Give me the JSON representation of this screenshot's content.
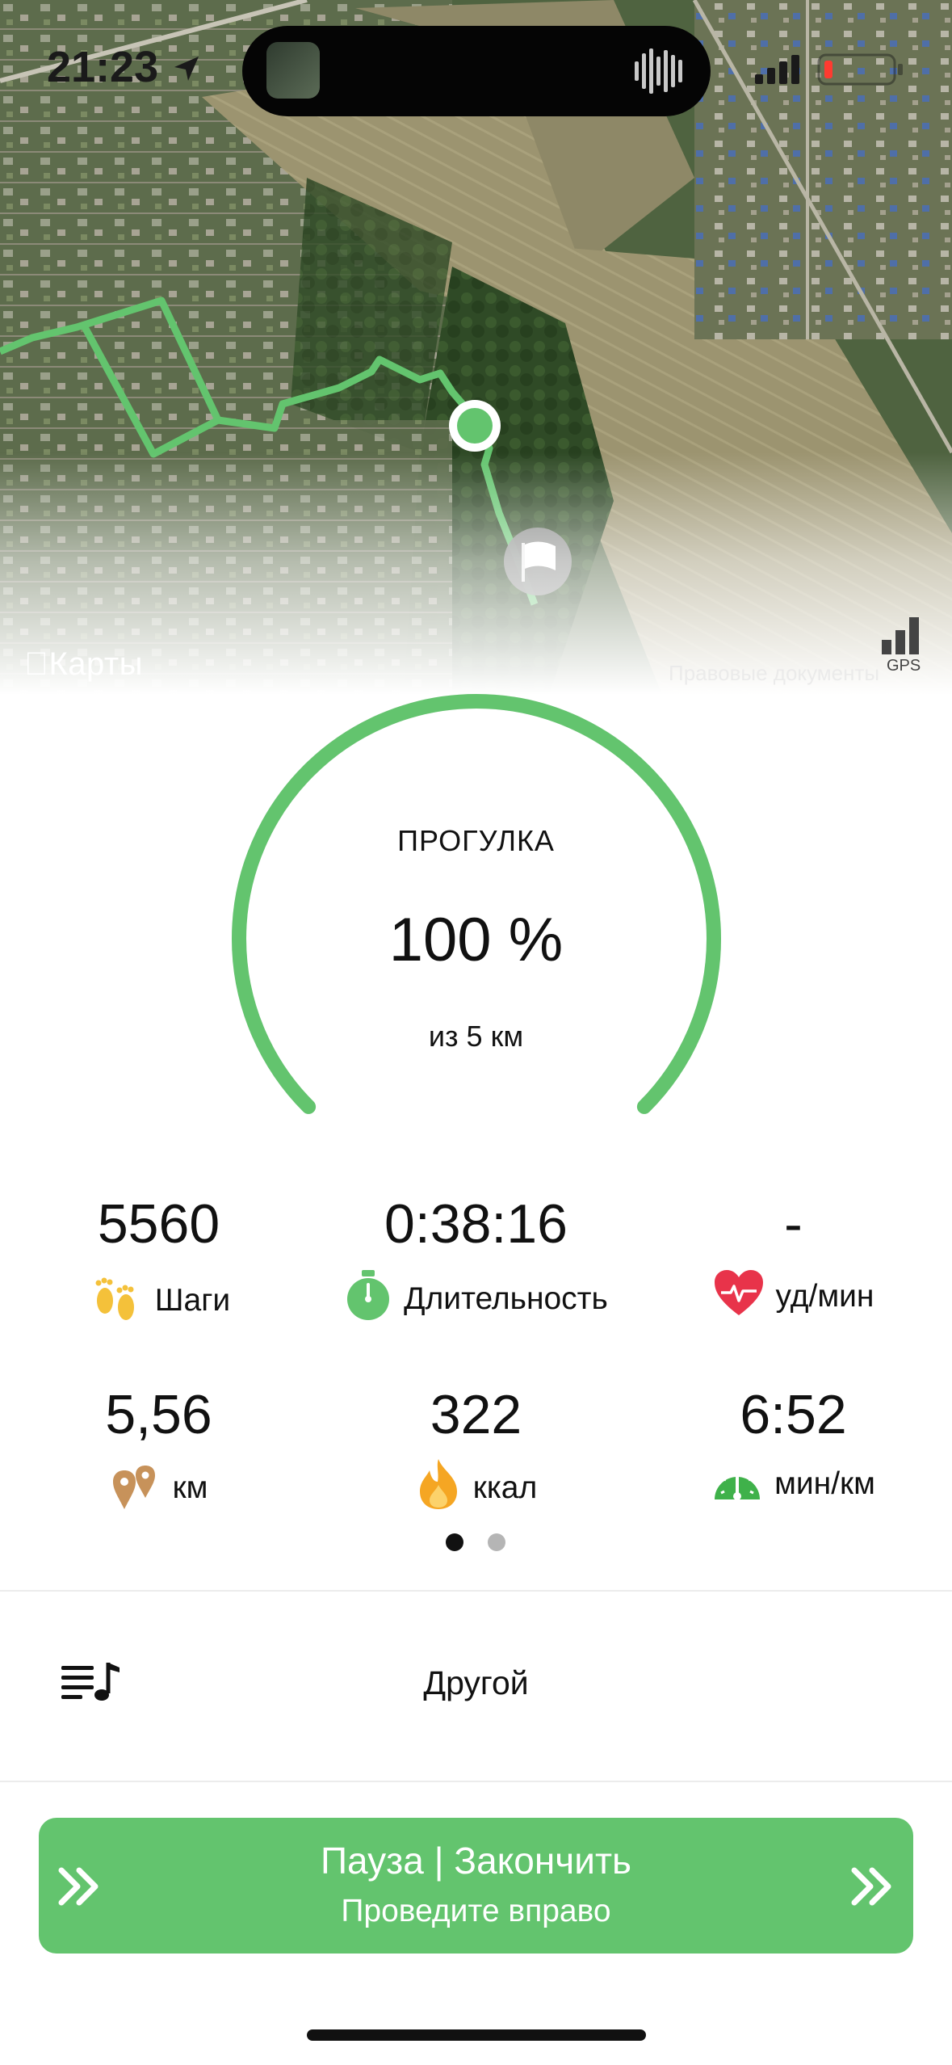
{
  "status_bar": {
    "time": "21:23"
  },
  "map": {
    "provider_label": "Карты",
    "legal_label": "Правовые документы",
    "gps_label": "GPS",
    "route_color": "#63c46e"
  },
  "activity": {
    "type": "ПРОГУЛКА",
    "progress_percent": 100,
    "progress_text": "100 %",
    "goal_text": "из 5 км",
    "accent_color": "#63c46e"
  },
  "stats": {
    "steps": {
      "value": "5560",
      "label": "Шаги",
      "icon": "footprints-icon"
    },
    "duration": {
      "value": "0:38:16",
      "label": "Длительность",
      "icon": "stopwatch-icon"
    },
    "heart_rate": {
      "value": "-",
      "label": "уд/мин",
      "icon": "heart-icon"
    },
    "distance": {
      "value": "5,56",
      "label": "км",
      "icon": "location-pins-icon"
    },
    "calories": {
      "value": "322",
      "label": "ккал",
      "icon": "flame-icon"
    },
    "pace": {
      "value": "6:52",
      "label": "мин/км",
      "icon": "speedometer-icon"
    }
  },
  "pager": {
    "pages": 2,
    "active": 0
  },
  "music": {
    "label": "Другой",
    "icon": "music-list-icon"
  },
  "control": {
    "title": "Пауза | Закончить",
    "subtitle": "Проведите вправо"
  }
}
